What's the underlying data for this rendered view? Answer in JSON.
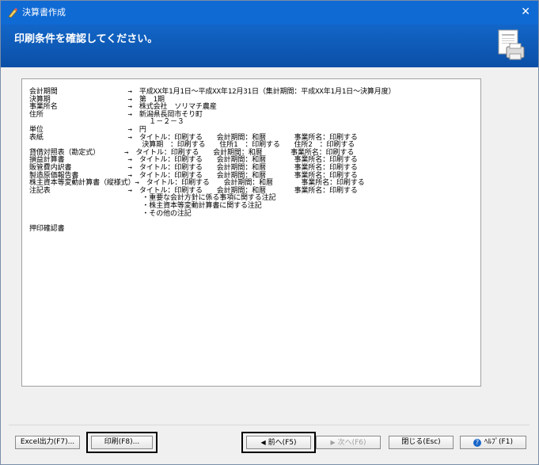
{
  "window": {
    "title": "決算書作成",
    "close_glyph": "✕",
    "heading": "印刷条件を確認してください。"
  },
  "summary": {
    "text": "会計期間　　　　　　　　　　→　平成XX年1月1日～平成XX年12月31日（集計期間：平成XX年1月1日～決算月度）\n決算期　　　　　　　　　　　→　第　1期\n事業所名　　　　　　　　　　→　株式会社　ソリマチ農産\n住所　　　　　　　　　　　　→　新潟県長岡市そり町\n　　　　　　　　　　　　　　　　　１－２－３\n単位　　　　　　　　　　　　→　円\n表紙　　　　　　　　　　　　→　タイトル：印刷する　　会計期間：和暦　　　　事業所名：印刷する\n　　　　　　　　　　　　　　　　決算期　：印刷する　　住所1　：印刷する　　住所2　：印刷する\n貸借対照表（勘定式）　　　　→　タイトル：印刷する　　会計期間：和暦　　　　事業所名：印刷する\n損益計算書　　　　　　　　　→　タイトル：印刷する　　会計期間：和暦　　　　事業所名：印刷する\n販管費内訳書　　　　　　　　→　タイトル：印刷する　　会計期間：和暦　　　　事業所名：印刷する\n製造原価報告書　　　　　　　→　タイトル：印刷する　　会計期間：和暦　　　　事業所名：印刷する\n株主資本等変動計算書（縦様式）→　タイトル：印刷する　　会計期間：和暦　　　　事業所名：印刷する\n注記表　　　　　　　　　　　→　タイトル：印刷する　　会計期間：和暦　　　　事業所名：印刷する\n　　　　　　　　　　　　　　　　・重要な会計方針に係る事項に関する注記\n　　　　　　　　　　　　　　　　・株主資本等変動計算書に関する注記\n　　　　　　　　　　　　　　　　・その他の注記\n\n押印確認書"
  },
  "buttons": {
    "excel": "Excel出力(F7)...",
    "print": "印刷(F8)...",
    "prev_icon": "◀",
    "prev": "前へ(F5)",
    "next_icon": "▶",
    "next": "次へ(F6)",
    "close": "閉じる(Esc)",
    "help_icon": "?",
    "help": "ﾍﾙﾌﾟ(F1)"
  },
  "colors": {
    "titlebar": "#0f6ad4",
    "header": "#0b4fa6",
    "highlight_border": "#000000"
  }
}
